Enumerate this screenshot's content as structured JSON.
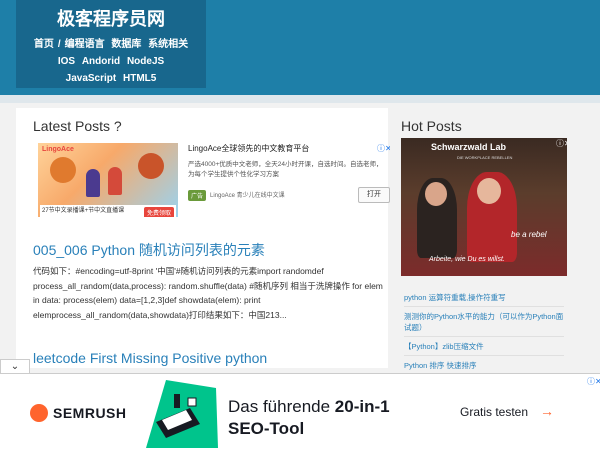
{
  "header": {
    "site_title": "极客程序员网",
    "nav": [
      [
        "首页",
        "编程语言",
        "数据库",
        "系统相关"
      ],
      [
        "IOS",
        "Andorid",
        "NodeJS"
      ],
      [
        "JavaScript",
        "HTML5"
      ]
    ],
    "nav_separator": "/"
  },
  "main": {
    "heading": "Latest Posts ?",
    "ad": {
      "logo": "LingoAce",
      "title": "LingoAce全球领先的中文教育平台",
      "description": "严选4000+优质中文老师，全天24小时开课，自选时间。自选老师，为每个学生提供个性化学习方案",
      "badge": "广告",
      "source": "LingoAce 青少儿在线中文课",
      "open_button": "打开",
      "image_caption": "27节中文录播课+节中文直播课",
      "image_cta": "免费领取",
      "ad_choices": "ⓘ✕"
    },
    "posts": [
      {
        "title": "005_006 Python 随机访问列表的元素",
        "excerpt": "代码如下：#encoding=utf-8print '中国'#随机访问列表的元素import randomdef process_all_random(data,process): random.shuffle(data) #随机序列 相当于洗牌操作 for elem in data: process(elem) data=[1,2,3]def showdata(elem): print elemprocess_all_random(data,showdata)打印结果如下：中国213..."
      },
      {
        "title": "leetcode First Missing Positive python"
      }
    ]
  },
  "sidebar": {
    "heading": "Hot Posts",
    "ad": {
      "brand": "Schwarzwald Lab",
      "tagline": "DIE WORKPLACE REBELLEN",
      "slogan": "Arbeite, wie Du es willst.",
      "slogan2": "be a rebel",
      "ad_choices": "ⓘ✕"
    },
    "hot_posts": [
      "python 运算符重载,操作符重写",
      "测测你的Python水平的能力（可以作为Python面试题）",
      "【Python】zlib压缩文件",
      "Python 排序 快速排序"
    ]
  },
  "bottom_ad": {
    "toggle": "⌄",
    "brand": "SEMRUSH",
    "headline_line1": "Das führende ",
    "headline_bold1": "20-in-1",
    "headline_bold2": "SEO-Tool",
    "cta": "Gratis testen",
    "cta_arrow": "→",
    "ad_choices": "ⓘ✕"
  },
  "colors": {
    "header": "#1e7fa8",
    "brand_box": "#18678d",
    "link": "#2980b9",
    "semrush_orange": "#ff642d"
  }
}
